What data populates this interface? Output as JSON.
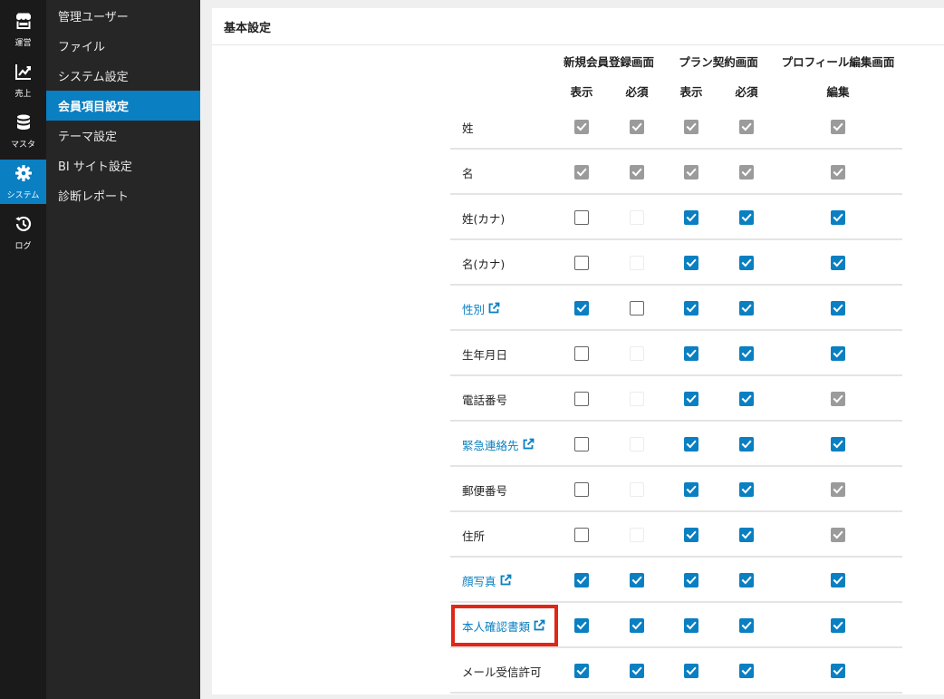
{
  "nav_rail": [
    {
      "icon": "store-icon",
      "label": "運営",
      "active": false
    },
    {
      "icon": "chart-icon",
      "label": "売上",
      "active": false
    },
    {
      "icon": "database-icon",
      "label": "マスタ",
      "active": false
    },
    {
      "icon": "gear-icon",
      "label": "システム",
      "active": true
    },
    {
      "icon": "history-icon",
      "label": "ログ",
      "active": false
    }
  ],
  "submenu": [
    {
      "label": "管理ユーザー",
      "active": false
    },
    {
      "label": "ファイル",
      "active": false
    },
    {
      "label": "システム設定",
      "active": false
    },
    {
      "label": "会員項目設定",
      "active": true
    },
    {
      "label": "テーマ設定",
      "active": false
    },
    {
      "label": "BI サイト設定",
      "active": false
    },
    {
      "label": "診断レポート",
      "active": false
    }
  ],
  "panel": {
    "title": "基本設定"
  },
  "table": {
    "groups": [
      "新規会員登録画面",
      "プラン契約画面",
      "プロフィール編集画面"
    ],
    "subheaders": [
      "表示",
      "必須",
      "表示",
      "必須",
      "編集"
    ],
    "rows": [
      {
        "label": "姓",
        "link": false,
        "cells": [
          "locked-checked",
          "locked-checked",
          "locked-checked",
          "locked-checked",
          "locked-checked"
        ]
      },
      {
        "label": "名",
        "link": false,
        "cells": [
          "locked-checked",
          "locked-checked",
          "locked-checked",
          "locked-checked",
          "locked-checked"
        ]
      },
      {
        "label": "姓(カナ)",
        "link": false,
        "cells": [
          "unchecked",
          "disabled",
          "checked",
          "checked",
          "checked"
        ]
      },
      {
        "label": "名(カナ)",
        "link": false,
        "cells": [
          "unchecked",
          "disabled",
          "checked",
          "checked",
          "checked"
        ]
      },
      {
        "label": "性別",
        "link": true,
        "cells": [
          "checked",
          "unchecked",
          "checked",
          "checked",
          "checked"
        ]
      },
      {
        "label": "生年月日",
        "link": false,
        "cells": [
          "unchecked",
          "disabled",
          "checked",
          "checked",
          "checked"
        ]
      },
      {
        "label": "電話番号",
        "link": false,
        "cells": [
          "unchecked",
          "disabled",
          "checked",
          "checked",
          "locked-checked"
        ]
      },
      {
        "label": "緊急連絡先",
        "link": true,
        "cells": [
          "unchecked",
          "disabled",
          "checked",
          "checked",
          "checked"
        ]
      },
      {
        "label": "郵便番号",
        "link": false,
        "cells": [
          "unchecked",
          "disabled",
          "checked",
          "checked",
          "locked-checked"
        ]
      },
      {
        "label": "住所",
        "link": false,
        "cells": [
          "unchecked",
          "disabled",
          "checked",
          "checked",
          "locked-checked"
        ]
      },
      {
        "label": "顔写真",
        "link": true,
        "cells": [
          "checked",
          "checked",
          "checked",
          "checked",
          "checked"
        ]
      },
      {
        "label": "本人確認書類",
        "link": true,
        "highlighted": true,
        "cells": [
          "checked",
          "checked",
          "checked",
          "checked",
          "checked"
        ]
      },
      {
        "label": "メール受信許可",
        "link": false,
        "cells": [
          "checked",
          "checked",
          "checked",
          "checked",
          "checked"
        ]
      }
    ]
  },
  "colors": {
    "accent": "#0a7fc2",
    "highlight": "#e02617",
    "rail_bg": "#1a1a1a",
    "menu_bg": "#262626",
    "locked_checkbox": "#9b9b9b"
  }
}
